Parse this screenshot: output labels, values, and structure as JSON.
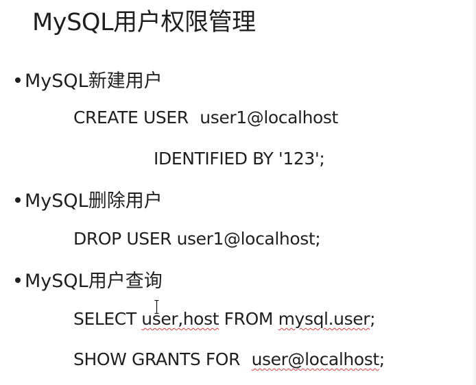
{
  "title": "MySQL用户权限管理",
  "sections": [
    {
      "heading": "MySQL新建用户",
      "lines": [
        {
          "parts": [
            "CREATE USER",
            "user1@localhost"
          ]
        },
        {
          "parts": [
            "IDENTIFIED BY '123';"
          ]
        }
      ]
    },
    {
      "heading": "MySQL删除用户",
      "lines": [
        {
          "parts": [
            "DROP USER user1@localhost;"
          ]
        }
      ]
    },
    {
      "heading": "MySQL用户查询",
      "lines": [
        {
          "parts": [
            "SELECT ",
            "user,host",
            " FROM ",
            "mysql.user",
            ";"
          ]
        },
        {
          "parts": [
            "SHOW GRANTS FOR",
            "user@localhost",
            ";"
          ]
        }
      ]
    }
  ],
  "colors": {
    "text": "#1f1f1f",
    "background": "#ffffff",
    "spellcheck_underline": "#e03a3a"
  },
  "icons": {
    "cursor": "i-beam-cursor-icon"
  }
}
